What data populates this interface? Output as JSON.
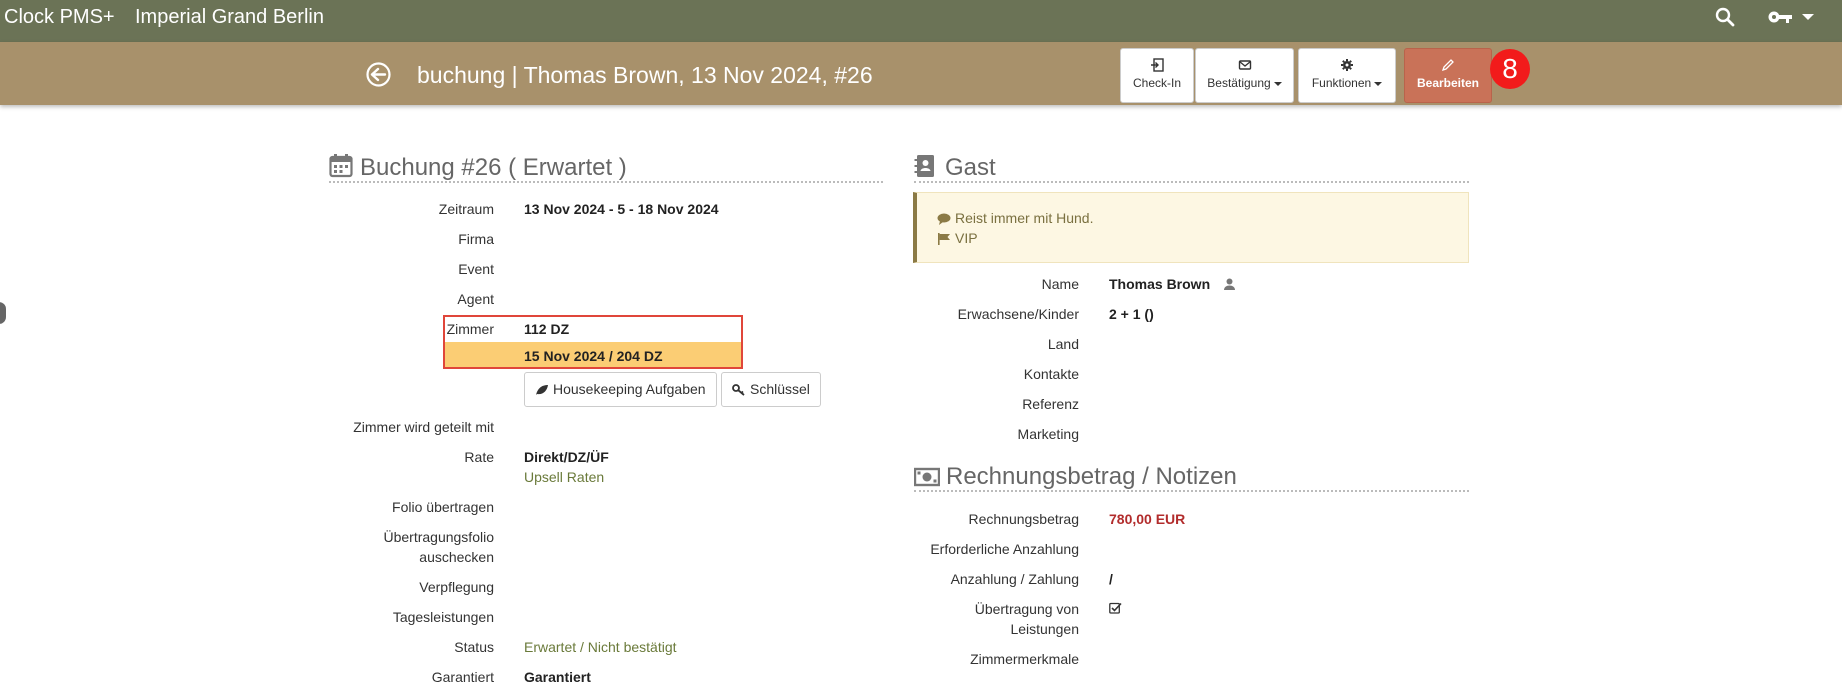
{
  "app": {
    "brand": "Clock PMS+",
    "hotel": "Imperial Grand Berlin"
  },
  "header": {
    "title": "buchung | Thomas Brown, 13 Nov 2024, #26",
    "buttons": {
      "checkin": "Check-In",
      "confirm": "Bestätigung",
      "functions": "Funktionen",
      "edit": "Bearbeiten"
    },
    "badge": "8"
  },
  "booking": {
    "section_title": "Buchung #26 ( Erwartet )",
    "rows": {
      "zeitraum": {
        "label": "Zeitraum",
        "value": "13 Nov 2024 - 5 - 18 Nov 2024"
      },
      "firma": {
        "label": "Firma"
      },
      "event": {
        "label": "Event"
      },
      "agent": {
        "label": "Agent"
      },
      "zimmer": {
        "label": "Zimmer",
        "value": "112 DZ",
        "value2": "15 Nov 2024 / 204 DZ"
      },
      "shared": {
        "label": "Zimmer wird geteilt mit"
      },
      "rate": {
        "label": "Rate",
        "value": "Direkt/DZ/ÜF",
        "link": "Upsell Raten"
      },
      "folio": {
        "label": "Folio übertragen"
      },
      "transfer_folio": {
        "label1": "Übertragungsfolio",
        "label2": "auschecken"
      },
      "meals": {
        "label": "Verpflegung"
      },
      "daily": {
        "label": "Tagesleistungen"
      },
      "status": {
        "label": "Status",
        "value": "Erwartet / Nicht bestätigt"
      },
      "guaranteed": {
        "label": "Garantiert",
        "value": "Garantiert"
      }
    },
    "buttons": {
      "housekeeping": "Housekeeping Aufgaben",
      "keys": "Schlüssel"
    }
  },
  "guest": {
    "section_title": "Gast",
    "notes": [
      "Reist immer mit Hund.",
      "VIP"
    ],
    "rows": {
      "name": {
        "label": "Name",
        "value": "Thomas Brown"
      },
      "pax": {
        "label": "Erwachsene/Kinder",
        "value": "2 + 1 ()"
      },
      "country": {
        "label": "Land"
      },
      "contacts": {
        "label": "Kontakte"
      },
      "reference": {
        "label": "Referenz"
      },
      "marketing": {
        "label": "Marketing"
      }
    }
  },
  "billing": {
    "section_title": "Rechnungsbetrag / Notizen",
    "rows": {
      "amount": {
        "label": "Rechnungsbetrag",
        "value": "780,00 EUR"
      },
      "deposit": {
        "label": "Erforderliche Anzahlung"
      },
      "payment": {
        "label": "Anzahlung / Zahlung",
        "value": "/"
      },
      "transfer": {
        "label1": "Übertragung von",
        "label2": "Leistungen"
      },
      "features": {
        "label": "Zimmermerkmale"
      }
    }
  },
  "colors": {
    "topbar": "#6b7356",
    "subbar": "#a8916b",
    "edit": "#c97258",
    "highlight": "#fbcd74",
    "amount": "#b22c2c"
  }
}
